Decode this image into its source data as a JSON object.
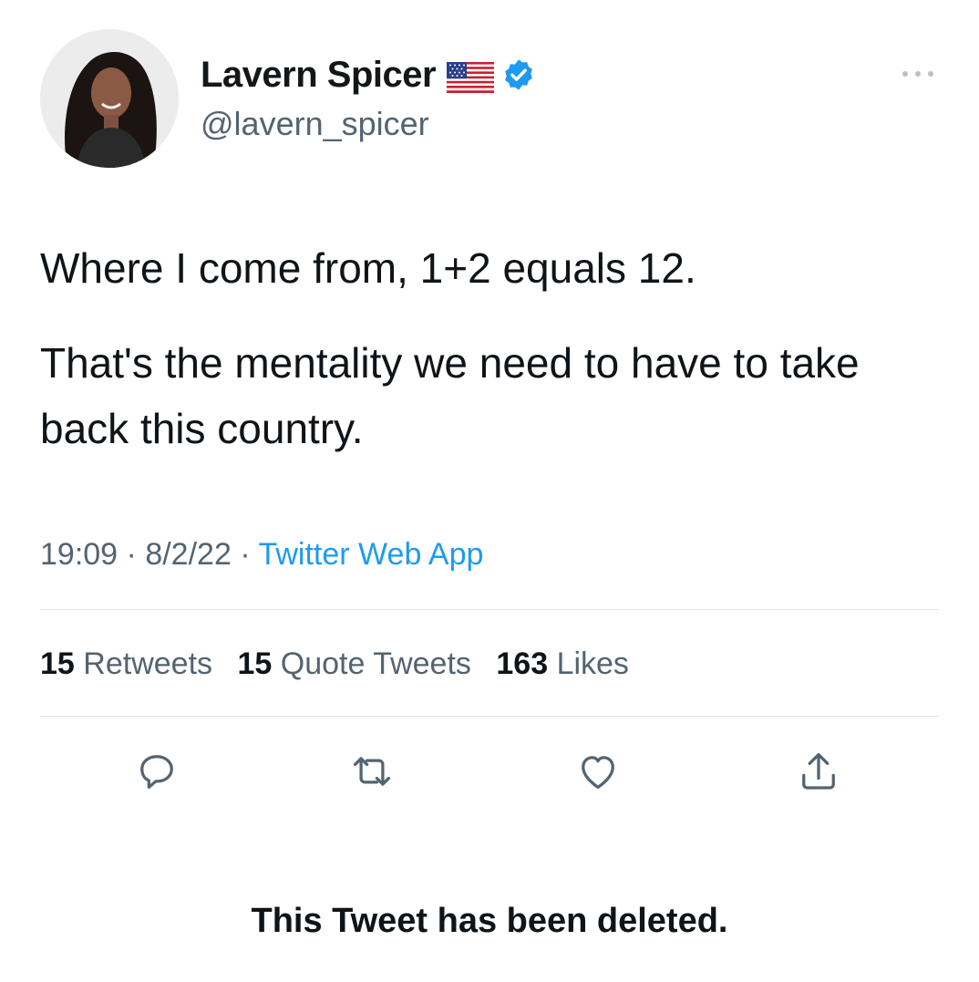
{
  "tweet": {
    "author": {
      "display_name": "Lavern Spicer",
      "handle": "@lavern_spicer",
      "badges": [
        "us-flag-icon",
        "verified-icon"
      ]
    },
    "text_lines": [
      "Where I come from, 1+2 equals 12.",
      "That's the mentality we need to have to take back this country."
    ],
    "meta": {
      "time": "19:09",
      "date": "8/2/22",
      "separator": "·",
      "source": "Twitter Web App"
    },
    "stats": {
      "retweets_count": "15",
      "retweets_label": "Retweets",
      "quotes_count": "15",
      "quotes_label": "Quote Tweets",
      "likes_count": "163",
      "likes_label": "Likes"
    },
    "actions": [
      "reply-icon",
      "retweet-icon",
      "like-icon",
      "share-icon"
    ],
    "notice": "This Tweet has been deleted."
  },
  "colors": {
    "accent": "#1d9bf0",
    "text": "#0f1419",
    "secondary_text": "#536471",
    "divider": "#dfe3e6"
  }
}
